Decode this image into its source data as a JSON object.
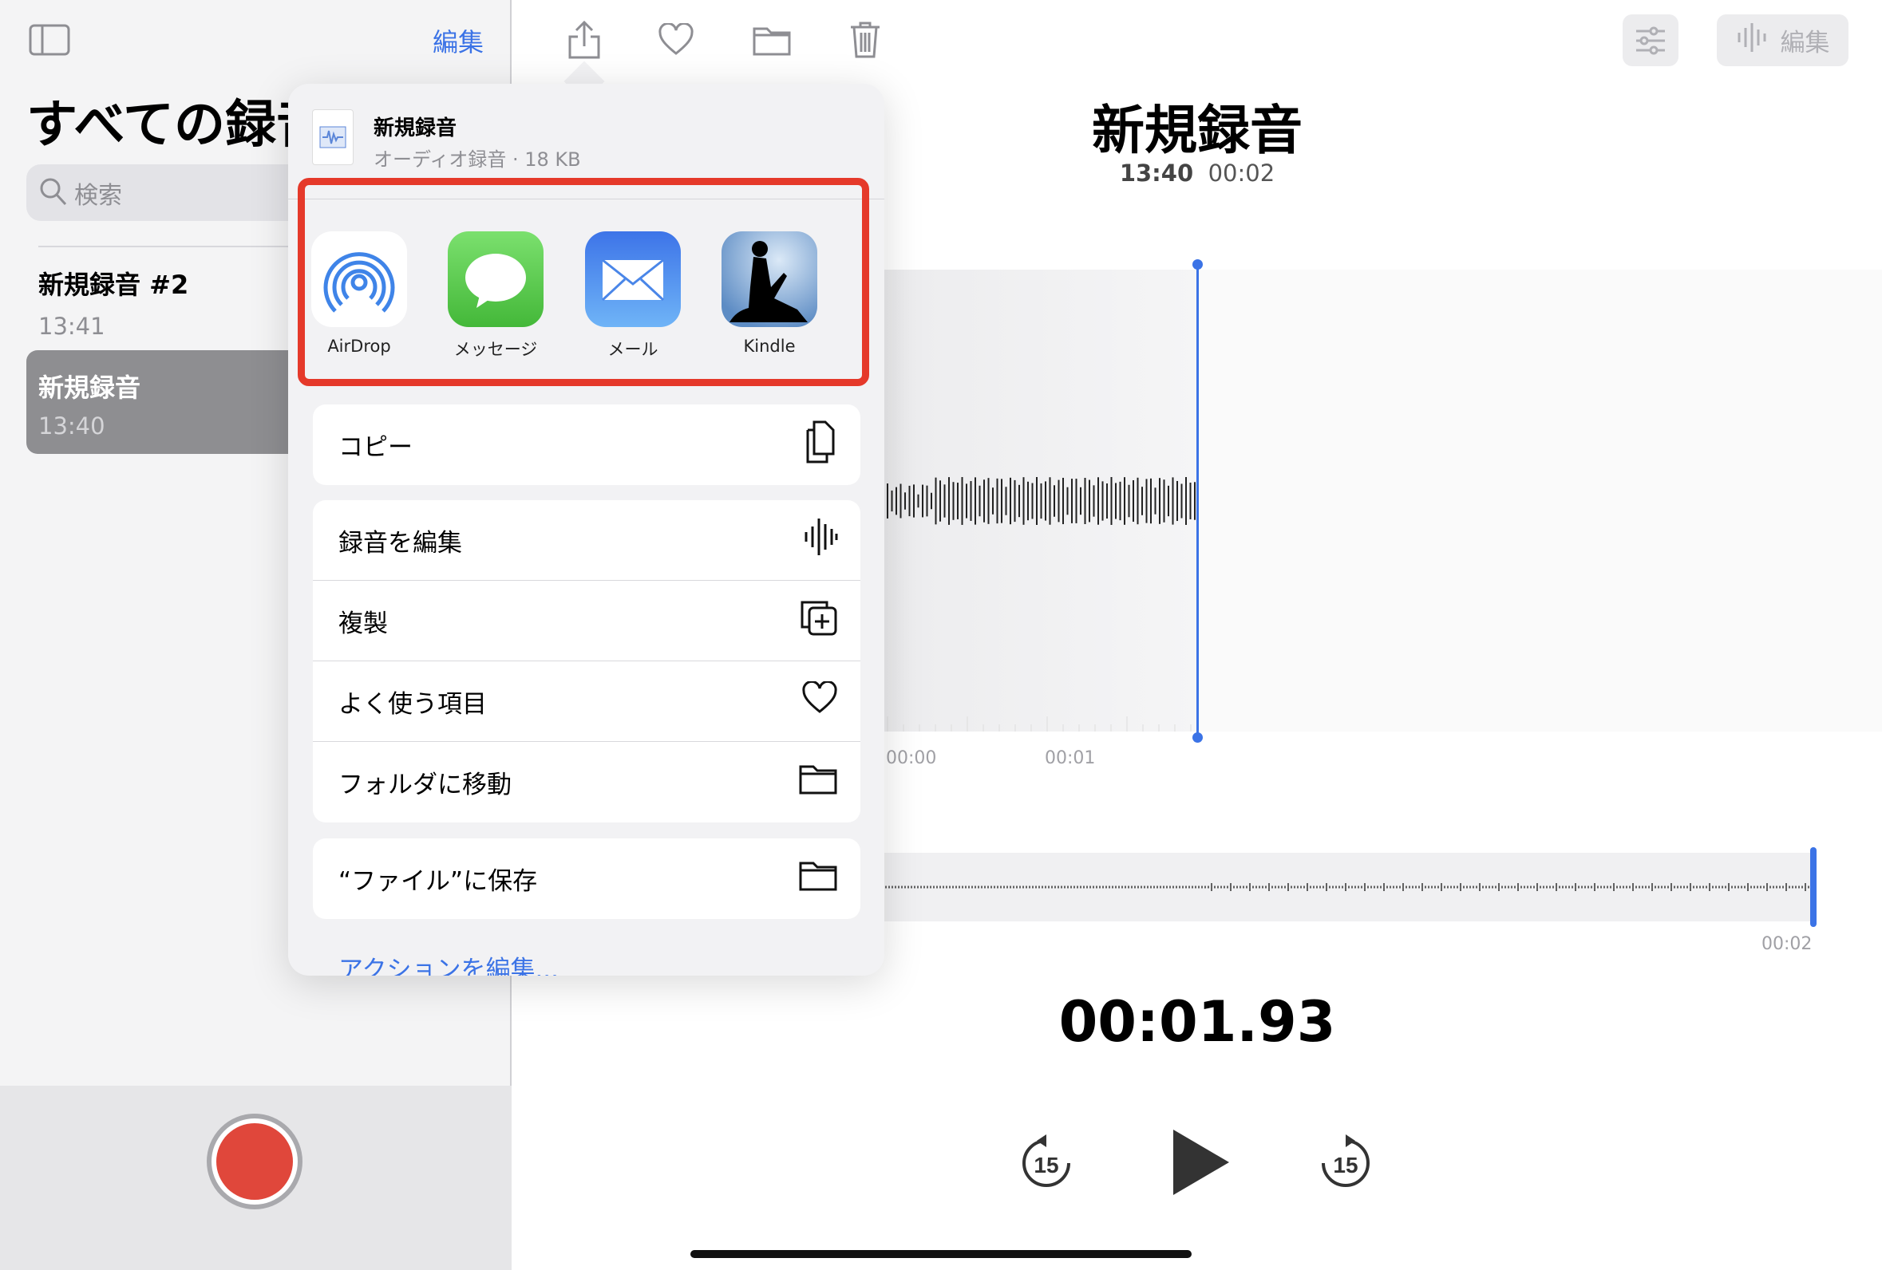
{
  "toolbar": {
    "edit": "編集",
    "right_edit": "編集",
    "icons": [
      "sidebar-icon",
      "share-icon",
      "heart-icon",
      "folder-icon",
      "trash-icon",
      "sliders-icon",
      "waveform-icon"
    ]
  },
  "sidebar": {
    "title": "すべての録音",
    "search_placeholder": "検索",
    "items": [
      {
        "title": "新規録音 #2",
        "time": "13:41"
      },
      {
        "title": "新規録音",
        "time": "13:40",
        "selected": true
      }
    ]
  },
  "share": {
    "file_name": "新規録音",
    "file_info": "オーディオ録音 · 18 KB",
    "apps": [
      {
        "label": "AirDrop",
        "icon": "airdrop-icon"
      },
      {
        "label": "メッセージ",
        "icon": "messages-icon"
      },
      {
        "label": "メール",
        "icon": "mail-icon"
      },
      {
        "label": "Kindle",
        "icon": "kindle-icon"
      }
    ],
    "copy": "コピー",
    "actions": [
      "録音を編集",
      "複製",
      "よく使う項目",
      "フォルダに移動"
    ],
    "save_files": "“ファイル”に保存",
    "edit_actions": "アクションを編集...",
    "highlight_color": "#e5392a"
  },
  "detail": {
    "title": "新規録音",
    "time": "13:40",
    "duration": "00:02",
    "ticks": [
      "00:00",
      "00:01"
    ],
    "overview_end": "00:02",
    "current": "00:01.93",
    "skip": "15",
    "accent": "#3b73e6"
  }
}
